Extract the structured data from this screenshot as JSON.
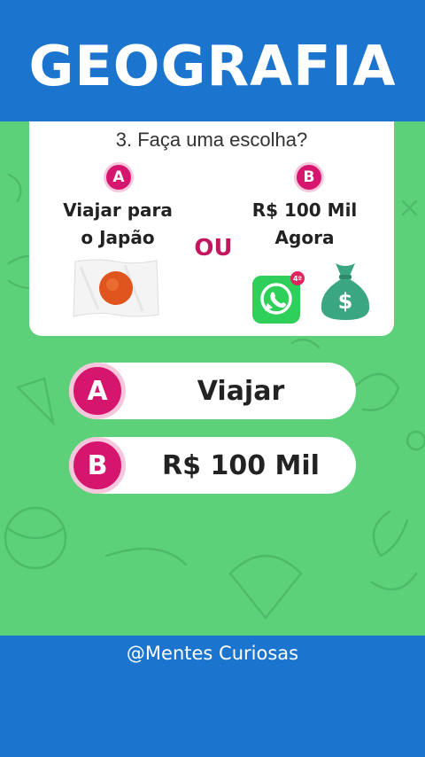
{
  "header": {
    "title": "GEOGRAFIA"
  },
  "question": {
    "text": "3. Faça uma escolha?",
    "separator": "OU",
    "options": [
      {
        "badge": "A",
        "line1": "Viajar para",
        "line2": "o Japão",
        "image": "japan-flag"
      },
      {
        "badge": "B",
        "line1": "R$ 100 Mil",
        "line2": "Agora",
        "image": "whatsapp-and-money-bag"
      }
    ],
    "whatsapp_badge": "4º"
  },
  "answers": [
    {
      "badge": "A",
      "label": "Viajar"
    },
    {
      "badge": "B",
      "label": "R$ 100 Mil"
    }
  ],
  "footer": {
    "handle": "@Mentes Curiosas"
  },
  "colors": {
    "brand_blue": "#1b74cd",
    "background_green": "#5dd17a",
    "accent_pink": "#d6166e",
    "whatsapp_green": "#2fd05a",
    "money_bag": "#3aa682"
  }
}
